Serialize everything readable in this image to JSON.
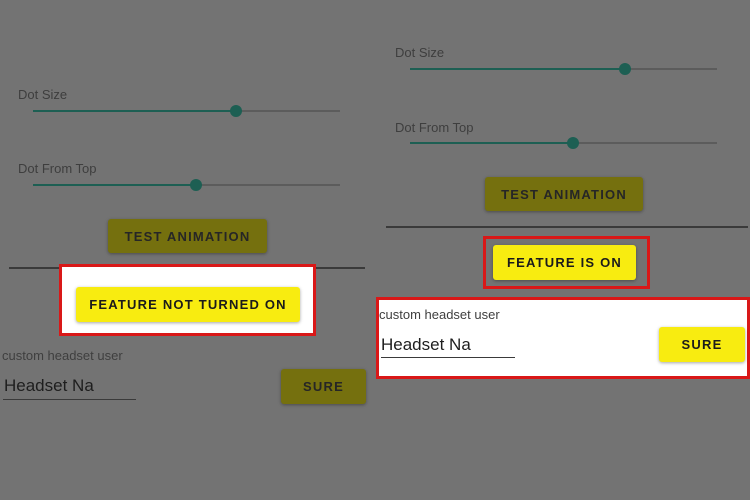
{
  "left": {
    "dot_size_label": "Dot Size",
    "dot_size_value": 0.66,
    "dot_from_top_label": "Dot From Top",
    "dot_from_top_value": 0.53,
    "test_animation_label": "TEST ANIMATION",
    "feature_button_label": "FEATURE NOT TURNED ON",
    "headset_label": "custom headset user",
    "headset_value": "Headset Na",
    "sure_label": "SURE"
  },
  "right": {
    "dot_size_label": "Dot Size",
    "dot_size_value": 0.7,
    "dot_from_top_label": "Dot From Top",
    "dot_from_top_value": 0.53,
    "test_animation_label": "TEST ANIMATION",
    "feature_button_label": "FEATURE IS ON",
    "headset_label": "custom headset user",
    "headset_value": "Headset Na",
    "sure_label": "SURE"
  },
  "colors": {
    "highlight_border": "#d91818",
    "button_yellow": "#f8ec10",
    "slider_teal": "#1d5f53"
  }
}
